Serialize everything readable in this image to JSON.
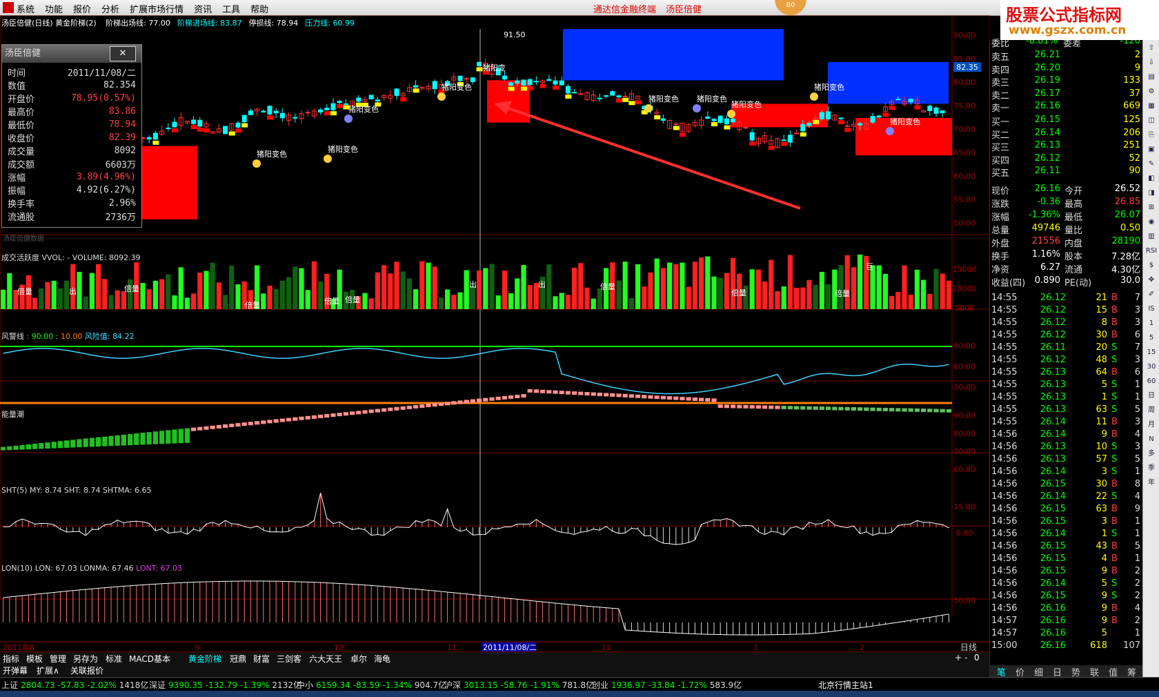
{
  "menu": {
    "items": [
      "系统",
      "功能",
      "报价",
      "分析",
      "扩展市场行情",
      "资讯",
      "工具",
      "帮助"
    ],
    "center": [
      "通达信金融终端",
      "汤臣倍健"
    ],
    "badge": "80"
  },
  "brand": {
    "name": "股票公式指标网",
    "url": "www.gszx.com.cn"
  },
  "main_chart": {
    "title": "汤臣倍健(日线) 黄金阶梯(2)",
    "params": [
      {
        "label": "阶梯出场线: 77.00",
        "color": "#ffffff"
      },
      {
        "label": "阶梯进场线: 83.87",
        "color": "#00ffff"
      },
      {
        "label": "停损线: 78.94",
        "color": "#ffffff"
      },
      {
        "label": "压力线: 60.99",
        "color": "#00ffff"
      }
    ],
    "y_ticks": [
      "90.00",
      "85.00",
      "80.00",
      "75.00",
      "70.00",
      "65.00",
      "60.00",
      "55.00",
      "50.00"
    ],
    "current_value": "82.35",
    "peak_label": "91.50",
    "signal_label": "猪阳变色",
    "signal_label_short": "猪阳变",
    "footnote": "汤臣倍健数据"
  },
  "infobox": {
    "title": "汤臣倍健",
    "close": "✕",
    "rows": [
      {
        "k": "时间",
        "v": "2011/11/08/二",
        "c": "#dddddd"
      },
      {
        "k": "数值",
        "v": "82.354",
        "c": "#dddddd"
      },
      {
        "k": "开盘价",
        "v": "78.95(0.57%)",
        "c": "#ff4040"
      },
      {
        "k": "最高价",
        "v": "83.86",
        "c": "#ff4040"
      },
      {
        "k": "最低价",
        "v": "78.94",
        "c": "#ff4040"
      },
      {
        "k": "收盘价",
        "v": "82.39",
        "c": "#ff4040"
      },
      {
        "k": "成交量",
        "v": "8092",
        "c": "#dddddd"
      },
      {
        "k": "成交额",
        "v": "6603万",
        "c": "#dddddd"
      },
      {
        "k": "涨幅",
        "v": "3.89(4.96%)",
        "c": "#ff4040"
      },
      {
        "k": "振幅",
        "v": "4.92(6.27%)",
        "c": "#dddddd"
      },
      {
        "k": "换手率",
        "v": "2.96%",
        "c": "#dddddd"
      },
      {
        "k": "流通股",
        "v": "2736万",
        "c": "#dddddd"
      }
    ]
  },
  "vol_panel": {
    "title": "成交活跃度 VVOL: -  VOLUME: 8092.39",
    "y_ticks": [
      "15000",
      "10000",
      "5000"
    ],
    "label": "倍量",
    "label2": "出",
    "label3": "巨"
  },
  "risk_panel": {
    "title": "风警线",
    "a": ": 90.00",
    "b": ": 10.00",
    "c": "风险值: 84.22",
    "y_ticks": [
      "90.00",
      "60.00",
      "30.00"
    ]
  },
  "energy_panel": {
    "title": "能量潮",
    "y_ticks": [
      "90.00",
      "80.00",
      "70.00",
      "60.00"
    ]
  },
  "sht_panel": {
    "title": "SHT(5)  MY: 8.74  SHT: 8.74  SHTMA: 6.65",
    "y_ticks": [
      "15.00",
      "0.00"
    ]
  },
  "lon_panel": {
    "title": "LON(10)  LON: 67.03  LONMA: 67.46",
    "lont": "LONT: 67.03",
    "y_ticks": [
      "50.00"
    ]
  },
  "x_axis": {
    "labels": [
      "2011年8",
      "9",
      "10",
      "11",
      "2011/11/08/二",
      "12",
      "1",
      "2"
    ],
    "period": "日线"
  },
  "tabs": [
    "指标",
    "模板",
    "管理",
    "另存为",
    "标准",
    "MACD基本",
    "黄金阶梯",
    "冠鼎",
    "财富",
    "三剑客",
    "六大天王",
    "卓尔",
    "海龟"
  ],
  "tabs_right": [
    "+",
    "-",
    "0"
  ],
  "tabs2": [
    "开弹幕",
    "扩展∧",
    "关联报价"
  ],
  "orderbook": {
    "partial": {
      "label": "委比",
      "v1": "-8.81%",
      "v2": "委差",
      "v3": "-120"
    },
    "asks": [
      {
        "k": "卖五",
        "p": "26.21",
        "q": "2"
      },
      {
        "k": "卖四",
        "p": "26.20",
        "q": "9"
      },
      {
        "k": "卖三",
        "p": "26.19",
        "q": "133"
      },
      {
        "k": "卖二",
        "p": "26.17",
        "q": "37"
      },
      {
        "k": "卖一",
        "p": "26.16",
        "q": "669"
      }
    ],
    "bids": [
      {
        "k": "买一",
        "p": "26.15",
        "q": "125"
      },
      {
        "k": "买二",
        "p": "26.14",
        "q": "206"
      },
      {
        "k": "买三",
        "p": "26.13",
        "q": "251"
      },
      {
        "k": "买四",
        "p": "26.12",
        "q": "52"
      },
      {
        "k": "买五",
        "p": "26.11",
        "q": "90"
      }
    ],
    "quote": [
      {
        "k1": "现价",
        "v1": "26.16",
        "c1": "#00ff00",
        "k2": "今开",
        "v2": "26.52",
        "c2": "#ffffff"
      },
      {
        "k1": "涨跌",
        "v1": "-0.36",
        "c1": "#00ff00",
        "k2": "最高",
        "v2": "26.85",
        "c2": "#ff4040"
      },
      {
        "k1": "涨幅",
        "v1": "-1.36%",
        "c1": "#00ff00",
        "k2": "最低",
        "v2": "26.07",
        "c2": "#00ff00"
      },
      {
        "k1": "总量",
        "v1": "49746",
        "c1": "#ffff00",
        "k2": "量比",
        "v2": "0.50",
        "c2": "#ffff00"
      },
      {
        "k1": "外盘",
        "v1": "21556",
        "c1": "#ff4040",
        "k2": "内盘",
        "v2": "28190",
        "c2": "#00ff00"
      },
      {
        "k1": "换手",
        "v1": "1.16%",
        "c1": "#ffffff",
        "k2": "股本",
        "v2": "7.28亿",
        "c2": "#ffffff"
      },
      {
        "k1": "净资",
        "v1": "6.27",
        "c1": "#ffffff",
        "k2": "流通",
        "v2": "4.30亿",
        "c2": "#ffffff"
      },
      {
        "k1": "收益(四)",
        "v1": "0.890",
        "c1": "#ffffff",
        "k2": "PE(动)",
        "v2": "30.0",
        "c2": "#ffffff"
      }
    ],
    "ticks": [
      [
        "14:55",
        "26.12",
        "21",
        "B",
        "7"
      ],
      [
        "14:55",
        "26.12",
        "15",
        "B",
        "3"
      ],
      [
        "14:55",
        "26.12",
        "8",
        "B",
        "3"
      ],
      [
        "14:55",
        "26.12",
        "30",
        "B",
        "6"
      ],
      [
        "14:55",
        "26.11",
        "20",
        "S",
        "7"
      ],
      [
        "14:55",
        "26.12",
        "48",
        "S",
        "3"
      ],
      [
        "14:55",
        "26.13",
        "64",
        "B",
        "6"
      ],
      [
        "14:55",
        "26.13",
        "5",
        "S",
        "1"
      ],
      [
        "14:55",
        "26.13",
        "1",
        "S",
        "1"
      ],
      [
        "14:55",
        "26.13",
        "63",
        "S",
        "5"
      ],
      [
        "14:55",
        "26.14",
        "11",
        "B",
        "3"
      ],
      [
        "14:56",
        "26.14",
        "9",
        "B",
        "4"
      ],
      [
        "14:56",
        "26.13",
        "10",
        "S",
        "3"
      ],
      [
        "14:56",
        "26.13",
        "57",
        "S",
        "5"
      ],
      [
        "14:56",
        "26.14",
        "3",
        "S",
        "1"
      ],
      [
        "14:56",
        "26.15",
        "30",
        "B",
        "8"
      ],
      [
        "14:56",
        "26.14",
        "22",
        "S",
        "4"
      ],
      [
        "14:56",
        "26.15",
        "63",
        "B",
        "9"
      ],
      [
        "14:56",
        "26.15",
        "3",
        "B",
        "1"
      ],
      [
        "14:56",
        "26.14",
        "1",
        "S",
        "1"
      ],
      [
        "14:56",
        "26.15",
        "43",
        "B",
        "5"
      ],
      [
        "14:56",
        "26.15",
        "4",
        "B",
        "1"
      ],
      [
        "14:56",
        "26.15",
        "9",
        "B",
        "2"
      ],
      [
        "14:56",
        "26.14",
        "5",
        "S",
        "2"
      ],
      [
        "14:56",
        "26.15",
        "9",
        "S",
        "2"
      ],
      [
        "14:56",
        "26.16",
        "9",
        "B",
        "4"
      ],
      [
        "14:57",
        "26.16",
        "9",
        "B",
        "2"
      ],
      [
        "14:57",
        "26.16",
        "5",
        "",
        "1"
      ],
      [
        "15:00",
        "26.16",
        "618",
        "",
        "107"
      ]
    ],
    "bottom_tabs": [
      "笔",
      "价",
      "细",
      "日",
      "势",
      "联",
      "值",
      "筹"
    ]
  },
  "right_toolbar": [
    "⇧",
    "⇩",
    "▤",
    "⚙",
    "▦",
    "◫",
    "⎘",
    "▣",
    "✎",
    "◧",
    "◨",
    "⊞",
    "◉",
    "▥",
    "RSI",
    "$",
    "✥",
    "✐",
    "IS",
    "1",
    "5",
    "15",
    "30",
    "60",
    "日",
    "周",
    "月",
    "N",
    "多",
    "季",
    "年"
  ],
  "status": {
    "items": [
      {
        "label": "上证",
        "v": "2804.73",
        "chg": "-57.83",
        "pct": "-2.02%",
        "amt": "1418亿"
      },
      {
        "label": "深证",
        "v": "9390.35",
        "chg": "-132.79",
        "pct": "-1.39%",
        "amt": "2132亿"
      },
      {
        "label": "中小",
        "v": "6159.34",
        "chg": "-83.59",
        "pct": "-1.34%",
        "amt": "904.7亿"
      },
      {
        "label": "沪深",
        "v": "3013.15",
        "chg": "-58.76",
        "pct": "-1.91%",
        "amt": "781.8亿"
      },
      {
        "label": "创业",
        "v": "1936.97",
        "chg": "-33.84",
        "pct": "-1.72%",
        "amt": "583.9亿"
      }
    ],
    "server": "北京行情主站1"
  }
}
